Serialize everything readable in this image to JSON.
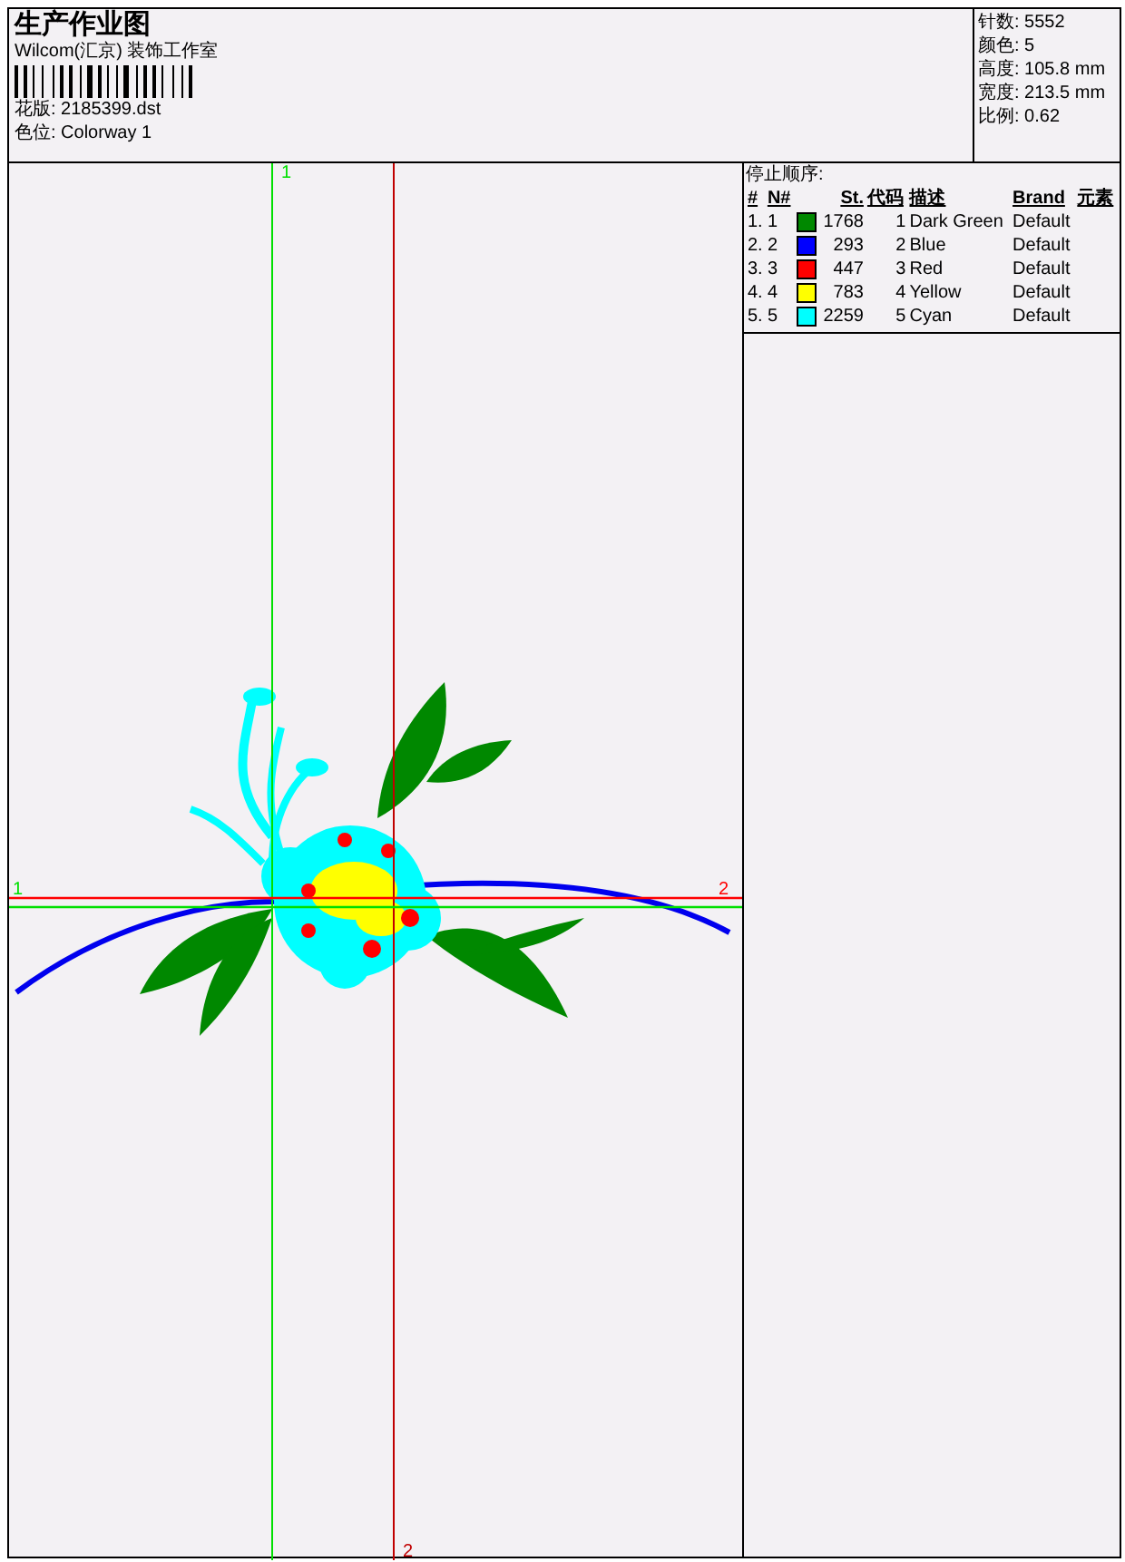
{
  "header": {
    "title": "生产作业图",
    "company": "Wilcom(汇京) 装饰工作室",
    "design_file": "花版: 2185399.dst",
    "colorway": "色位: Colorway 1"
  },
  "stats": [
    "针数: 5552",
    "颜色: 5",
    "高度: 105.8 mm",
    "宽度: 213.5 mm",
    "比例: 0.62"
  ],
  "guides": [
    {
      "kind": "vertical",
      "label": "1",
      "color": "#00e000"
    },
    {
      "kind": "vertical",
      "label": "2",
      "color": "#c00000"
    },
    {
      "kind": "horizontal",
      "label": "1",
      "color": "#00e000"
    },
    {
      "kind": "horizontal",
      "label": "2",
      "color": "#ff0000"
    }
  ],
  "stop_sequence": {
    "title": "停止顺序:",
    "columns": [
      "#",
      "N#",
      "St.",
      "代码",
      "描述",
      "Brand",
      "元素"
    ],
    "rows": [
      {
        "index": "1.",
        "number": "1",
        "color": "#008800",
        "stitches": "1768",
        "code": "1",
        "description": "Dark Green",
        "brand": "Default"
      },
      {
        "index": "2.",
        "number": "2",
        "color": "#0000ff",
        "stitches": "293",
        "code": "2",
        "description": "Blue",
        "brand": "Default"
      },
      {
        "index": "3.",
        "number": "3",
        "color": "#ff0000",
        "stitches": "447",
        "code": "3",
        "description": "Red",
        "brand": "Default"
      },
      {
        "index": "4.",
        "number": "4",
        "color": "#ffff00",
        "stitches": "783",
        "code": "4",
        "description": "Yellow",
        "brand": "Default"
      },
      {
        "index": "5.",
        "number": "5",
        "color": "#00ffff",
        "stitches": "2259",
        "code": "5",
        "description": "Cyan",
        "brand": "Default"
      }
    ]
  }
}
